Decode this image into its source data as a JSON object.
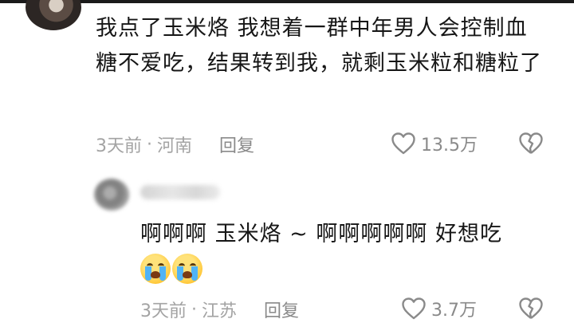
{
  "comments": [
    {
      "text": "我点了玉米烙 我想着一群中年男人会控制血糖不爱吃，结果转到我，就剩玉米粒和糖粒了",
      "time": "3天前",
      "location": "河南",
      "reply_label": "回复",
      "likes": "13.5万"
    },
    {
      "text": "啊啊啊 玉米烙 ~ 啊啊啊啊啊  好想吃",
      "emoji": [
        "loudly-crying-face",
        "loudly-crying-face"
      ],
      "time": "3天前",
      "location": "江苏",
      "reply_label": "回复",
      "likes": "3.7万"
    }
  ],
  "meta_separator": "·",
  "colors": {
    "text": "#161616",
    "meta": "#a3a3a3",
    "icon": "#8a8a8a"
  }
}
